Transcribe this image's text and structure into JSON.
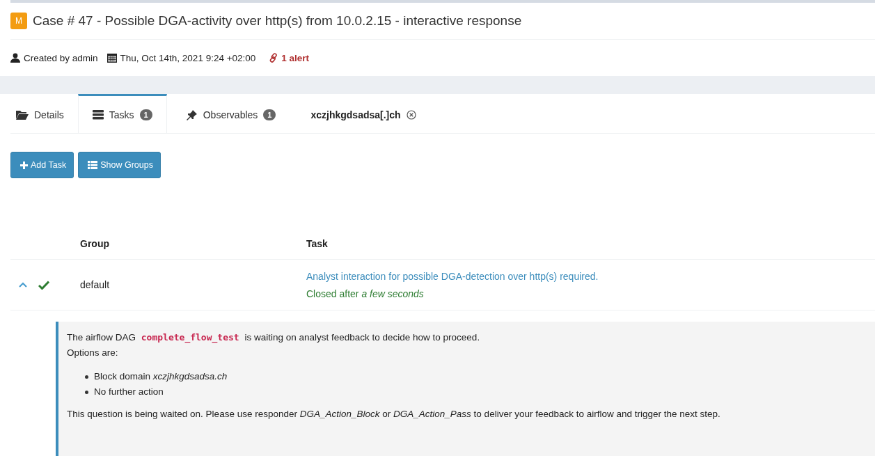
{
  "case": {
    "severity_badge": "M",
    "title": "Case # 47 - Possible DGA-activity over http(s) from 10.0.2.15 - interactive response"
  },
  "meta": {
    "created_by": "Created by admin",
    "date": "Thu, Oct 14th, 2021 9:24 +02:00",
    "alerts": "1 alert"
  },
  "tabs": [
    {
      "kind": "details",
      "label": "Details",
      "selected": false
    },
    {
      "kind": "tasks",
      "label": "Tasks",
      "count": "1",
      "selected": true
    },
    {
      "kind": "observables",
      "label": "Observables",
      "count": "1",
      "selected": false
    },
    {
      "kind": "observable",
      "label": "xczjhkgdsadsa[.]ch",
      "closable": true,
      "selected": false
    }
  ],
  "buttons": [
    {
      "kind": "add",
      "label": "Add Task"
    },
    {
      "kind": "list",
      "label": "Show Groups"
    }
  ],
  "table": {
    "columns": [
      "Group",
      "Task"
    ],
    "rows": [
      {
        "expanded": true,
        "done": true,
        "group": "default",
        "task": "Analyst interaction for possible DGA-detection over http(s) required.",
        "status": "Closed after *a few seconds*"
      }
    ]
  },
  "detail": {
    "intro_before": "The airflow DAG",
    "code": "complete_flow_test",
    "intro_after": "is waiting on analyst feedback to decide how to proceed.",
    "options_label": "Options are:",
    "options": [
      "Block domain *xczjhkgdsadsa.ch*",
      "No further action"
    ],
    "footer": "This question is being waited on. Please use responder *DGA_Action_Block* or *DGA_Action_Pass* to deliver your feedback to airflow and trigger the next step."
  }
}
